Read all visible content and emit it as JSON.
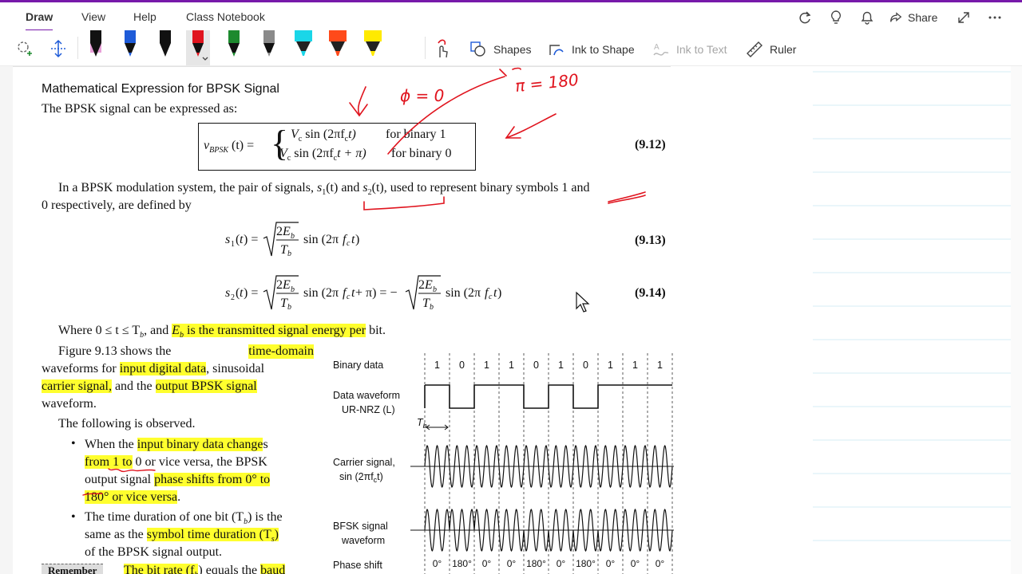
{
  "menu": {
    "tabs": [
      {
        "label": "Draw",
        "active": true
      },
      {
        "label": "View"
      },
      {
        "label": "Help"
      },
      {
        "label": "Class Notebook"
      }
    ],
    "share_label": "Share"
  },
  "toolbar": {
    "shapes_label": "Shapes",
    "ink_to_shape_label": "Ink to Shape",
    "ink_to_text_label": "Ink to Text",
    "ruler_label": "Ruler",
    "pens": [
      {
        "name": "pen-black-pink",
        "color": "#111111",
        "accent": "#e8a0d8"
      },
      {
        "name": "pen-blue",
        "color": "#1e5bd8"
      },
      {
        "name": "pen-black",
        "color": "#111111"
      },
      {
        "name": "pen-red",
        "color": "#e0141e"
      },
      {
        "name": "pen-green",
        "color": "#1d8a2e"
      },
      {
        "name": "pen-gray",
        "color": "#8a8a8a"
      },
      {
        "name": "highlighter-cyan",
        "color": "#1ad6e8"
      },
      {
        "name": "highlighter-orange",
        "color": "#ff4a1a"
      },
      {
        "name": "highlighter-yellow",
        "color": "#ffea00"
      }
    ]
  },
  "doc": {
    "heading": "Mathematical Expression for BPSK Signal",
    "intro": "The BPSK signal can be expressed as:",
    "eq1": {
      "lhs": "v",
      "lhs_sub": "BPSK",
      "lhs_arg": "(t) =",
      "row1": "V",
      "row1_rest": "sin (2πf",
      "row1_end": "t)",
      "row1_cond": "for binary 1",
      "row2": "V",
      "row2_rest": "sin (2πf",
      "row2_end": "t + π)",
      "row2_cond": "for binary 0",
      "sub_c": "c",
      "number": "(9.12)"
    },
    "para1_a": "In a BPSK modulation system, the pair of signals,",
    "para1_s1": "s",
    "para1_and": "(t) and",
    "para1_s2": "s",
    "para1_b": "(t), used to represent binary symbols 1 and",
    "para1_c": "0 respectively, are defined by",
    "eq2_number": "(9.13)",
    "eq3_number": "(9.14)",
    "where_a": "Where 0 ≤ t ≤ T",
    "where_b": ", and",
    "where_eb": "E",
    "where_hl": "is the transmitted signal energy per",
    "where_end": "bit.",
    "fig_p1": "Figure  9.13  shows  the",
    "fig_p1_hl": "time-domain",
    "fig_p2": "waveforms for",
    "fig_p2_hl": "input digital data",
    "fig_p2_end": ", sinusoidal",
    "fig_p3_hl": "carrier signal,",
    "fig_p3": "and the",
    "fig_p3_hl2": "output BPSK signal",
    "fig_p4": "waveform.",
    "observed": "The following is observed.",
    "b1_l1_a": "When the",
    "b1_l1_hl": "input binary data change",
    "b1_l1_end": "s",
    "b1_l2_hl": "from 1 to",
    "b1_l2": "0 or vice versa, the BPSK",
    "b1_l3": "output signal",
    "b1_l3_hl": "phase shifts from 0° to",
    "b1_l4_hl": "180° or vice versa",
    "b1_l4_end": ".",
    "b2_l1": "The time duration of one bit (T",
    "b2_l1_end": ") is the",
    "b2_l2": "same as the",
    "b2_l2_hl": "symbol time duration (T",
    "b2_l2_end": ")",
    "b2_l3": "of the BPSK signal output.",
    "remember": "Remember",
    "last_hl": "The bit rate (f",
    "last_mid": ") equals the",
    "last_hl2": "baud"
  },
  "figure": {
    "binary_label": "Binary data",
    "bits": [
      "1",
      "0",
      "1",
      "1",
      "0",
      "1",
      "0",
      "1",
      "1",
      "1"
    ],
    "data_label_1": "Data waveform",
    "data_label_2": "UR-NRZ (L)",
    "tb_label": "T",
    "tb_sub": "b",
    "carrier_label_1": "Carrier signal,",
    "carrier_label_2": "sin (2πf",
    "carrier_label_3": "t)",
    "bfsk_label_1": "BFSK signal",
    "bfsk_label_2": "waveform",
    "phase_label": "Phase shift",
    "phases": [
      "0°",
      "180°",
      "0°",
      "0°",
      "180°",
      "0°",
      "180°",
      "0°",
      "0°",
      "0°"
    ]
  },
  "ink": {
    "phi": "ϕ = 0",
    "pi": "π = 180"
  }
}
